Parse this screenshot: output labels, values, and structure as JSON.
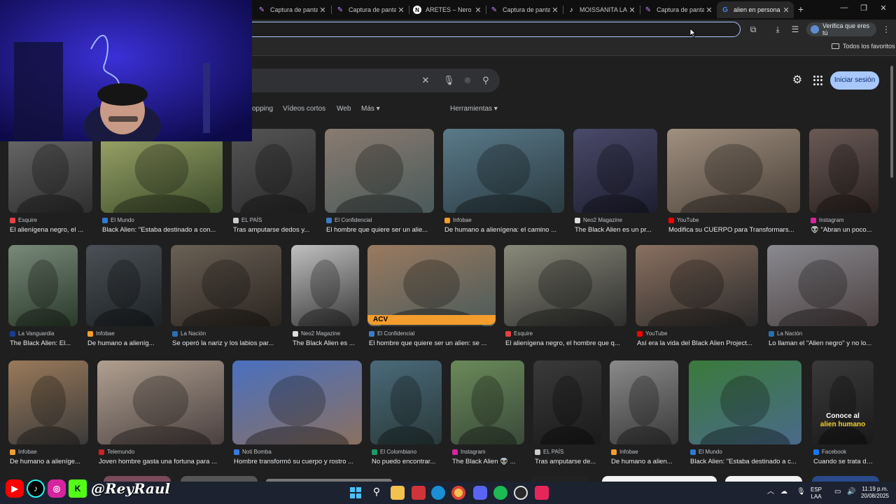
{
  "browser": {
    "tabs": [
      {
        "title": "Captura de pantalla",
        "icon": "pen-icon"
      },
      {
        "title": "Captura de pantalla",
        "icon": "pen-icon"
      },
      {
        "title": "ARETES – Nero Co",
        "icon": "n-logo-icon"
      },
      {
        "title": "Captura de pantalla",
        "icon": "pen-icon"
      },
      {
        "title": "MOISSANITA LAB",
        "icon": "tiktok-icon"
      },
      {
        "title": "Captura de pantalla",
        "icon": "pen-icon"
      },
      {
        "title": "alien en persona",
        "icon": "google-icon",
        "active": true
      }
    ],
    "verify_button": "Verifica que eres tú",
    "bookmarks_all": "Todos los favoritos"
  },
  "search": {
    "filters": [
      {
        "label": "opping"
      },
      {
        "label": "Vídeos cortos"
      },
      {
        "label": "Web"
      },
      {
        "label": "Más ▾"
      }
    ],
    "tools": "Herramientas ▾",
    "signin": "Iniciar sesión"
  },
  "results": {
    "row1": [
      {
        "source": "Esquire",
        "caption": "El alienígena negro, el ...",
        "fav": "#e84141",
        "tone": [
          "#6b6b6b",
          "#2e2e2e"
        ]
      },
      {
        "source": "El Mundo",
        "caption": "Black Alien: \"Estaba destinado a con...",
        "fav": "#2d7bd4",
        "tone": [
          "#9fa86a",
          "#3a4a2a"
        ]
      },
      {
        "source": "EL PAÍS",
        "caption": "Tras amputarse dedos y...",
        "fav": "#cccccc",
        "tone": [
          "#555555",
          "#2a2a2a"
        ]
      },
      {
        "source": "El Confidencial",
        "caption": "El hombre que quiere ser un alie...",
        "fav": "#3b7bc9",
        "tone": [
          "#8a7b70",
          "#4a5a5a"
        ]
      },
      {
        "source": "Infobae",
        "caption": "De humano a alienígena: el camino ...",
        "fav": "#f29d2e",
        "tone": [
          "#5a7a8a",
          "#2a3a40"
        ]
      },
      {
        "source": "Neo2 Magazine",
        "caption": "The Black Alien es un pr...",
        "fav": "#dddddd",
        "tone": [
          "#4a4a6a",
          "#1e1e30"
        ]
      },
      {
        "source": "YouTube",
        "caption": "Modifica su CUERPO para Transformars...",
        "fav": "#ff0000",
        "tone": [
          "#a09080",
          "#4a4038"
        ]
      },
      {
        "source": "Instagram",
        "caption": "👽 \"Abran un poco...",
        "fav": "#d6249f",
        "tone": [
          "#6a5a55",
          "#2a2220"
        ]
      }
    ],
    "row2": [
      {
        "source": "La Vanguardia",
        "caption": "The Black Alien: El...",
        "fav": "#1a3c8c",
        "tone": [
          "#7a8a7a",
          "#2a3a2a"
        ]
      },
      {
        "source": "Infobae",
        "caption": "De humano a alieníg...",
        "fav": "#f29d2e",
        "tone": [
          "#4a5055",
          "#1e2225"
        ]
      },
      {
        "source": "La Nación",
        "caption": "Se operó la nariz y los labios par...",
        "fav": "#2a6fb0",
        "tone": [
          "#6a6055",
          "#2a2520"
        ]
      },
      {
        "source": "Neo2 Magazine",
        "caption": "The Black Alien es ...",
        "fav": "#dddddd",
        "tone": [
          "#c0c0c0",
          "#3a3a3a"
        ]
      },
      {
        "source": "El Confidencial",
        "caption": "El hombre que quiere ser un alien: se ...",
        "fav": "#3b7bc9",
        "tone": [
          "#9a7a60",
          "#4a5a5a"
        ]
      },
      {
        "source": "Esquire",
        "caption": "El alienígena negro, el hombre que q...",
        "fav": "#e84141",
        "tone": [
          "#8a8a7a",
          "#2e2e2e"
        ]
      },
      {
        "source": "YouTube",
        "caption": "Así era la vida del Black Alien Project...",
        "fav": "#ff0000",
        "tone": [
          "#8a7060",
          "#2a2a2a"
        ]
      },
      {
        "source": "La Nación",
        "caption": "Lo llaman el \"Alien negro\" y no lo...",
        "fav": "#2a6fb0",
        "tone": [
          "#8a8a90",
          "#4a4040"
        ]
      }
    ],
    "row3": [
      {
        "source": "Infobae",
        "caption": "De humano a alieníge...",
        "fav": "#f29d2e",
        "tone": [
          "#9a7a5a",
          "#3a3a3a"
        ]
      },
      {
        "source": "Telemundo",
        "caption": "Joven hombre gasta una fortuna para ...",
        "fav": "#d02020",
        "tone": [
          "#b0a090",
          "#4a4040"
        ]
      },
      {
        "source": "Noti Bomba",
        "caption": "Hombre transformó su cuerpo y rostro ...",
        "fav": "#3a7ae0",
        "tone": [
          "#4a70c0",
          "#8a7060"
        ]
      },
      {
        "source": "El Colombiano",
        "caption": "No puedo encontrar...",
        "fav": "#1a9a6a",
        "tone": [
          "#4a6a7a",
          "#2a3a3a"
        ]
      },
      {
        "source": "Instagram",
        "caption": "The Black Alien 👽 ...",
        "fav": "#d6249f",
        "tone": [
          "#6a8a5a",
          "#3a4a3a"
        ]
      },
      {
        "source": "EL PAÍS",
        "caption": "Tras amputarse de...",
        "fav": "#cccccc",
        "tone": [
          "#3a3a3a",
          "#1a1a1a"
        ]
      },
      {
        "source": "Infobae",
        "caption": "De humano a alien...",
        "fav": "#f29d2e",
        "tone": [
          "#8a8a8a",
          "#3a3a3a"
        ]
      },
      {
        "source": "El Mundo",
        "caption": "Black Alien: \"Estaba destinado a c...",
        "fav": "#2d7bd4",
        "tone": [
          "#3a7a3a",
          "#4a6a8a"
        ]
      },
      {
        "source": "Facebook",
        "caption": "Cuando se trata de...",
        "fav": "#1877f2",
        "tone": [
          "#3a3a3a",
          "#1a1a1a"
        ]
      }
    ],
    "overlay_text": [
      "Conoce al",
      "alien humano"
    ],
    "acv_badge": "ACV"
  },
  "stream_overlay": {
    "handle": "@ReyRaul"
  },
  "taskbar": {
    "lang": [
      "ESP",
      "LAA"
    ],
    "time": "11:19 p.m.",
    "date": "20/08/2025"
  }
}
